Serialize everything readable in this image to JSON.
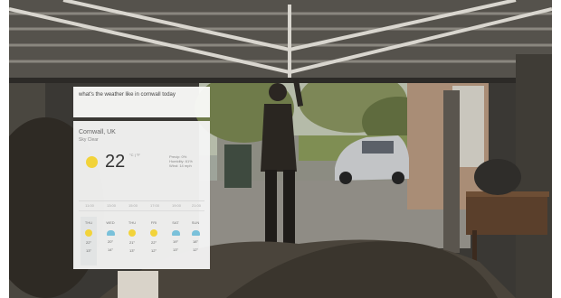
{
  "assistant": {
    "query": "what's the weather like in cornwall today"
  },
  "weather": {
    "location": "Cornwall, UK",
    "condition": "Sky Clear",
    "temperature": "22",
    "unit": "°C | °F",
    "details": [
      "Precip: 0%",
      "Humidity: 61%",
      "Wind: 14 mph"
    ],
    "hours": [
      "11:00",
      "13:00",
      "15:00",
      "17:00",
      "19:00",
      "21:00"
    ],
    "days": [
      {
        "name": "THU",
        "icon": "sun-icon",
        "high": "22°",
        "low": "13°"
      },
      {
        "name": "WED",
        "icon": "cloud-icon",
        "high": "20°",
        "low": "14°"
      },
      {
        "name": "THU",
        "icon": "sun-icon",
        "high": "21°",
        "low": "13°"
      },
      {
        "name": "FRI",
        "icon": "sun-icon",
        "high": "22°",
        "low": "12°"
      },
      {
        "name": "SAT",
        "icon": "cloud-icon",
        "high": "19°",
        "low": "13°"
      },
      {
        "name": "SUN",
        "icon": "cloud-icon",
        "high": "18°",
        "low": "12°"
      }
    ]
  },
  "colors": {
    "sun": "#f2d33a",
    "cloud": "#7ac1da",
    "card": "#f5f6f6"
  }
}
